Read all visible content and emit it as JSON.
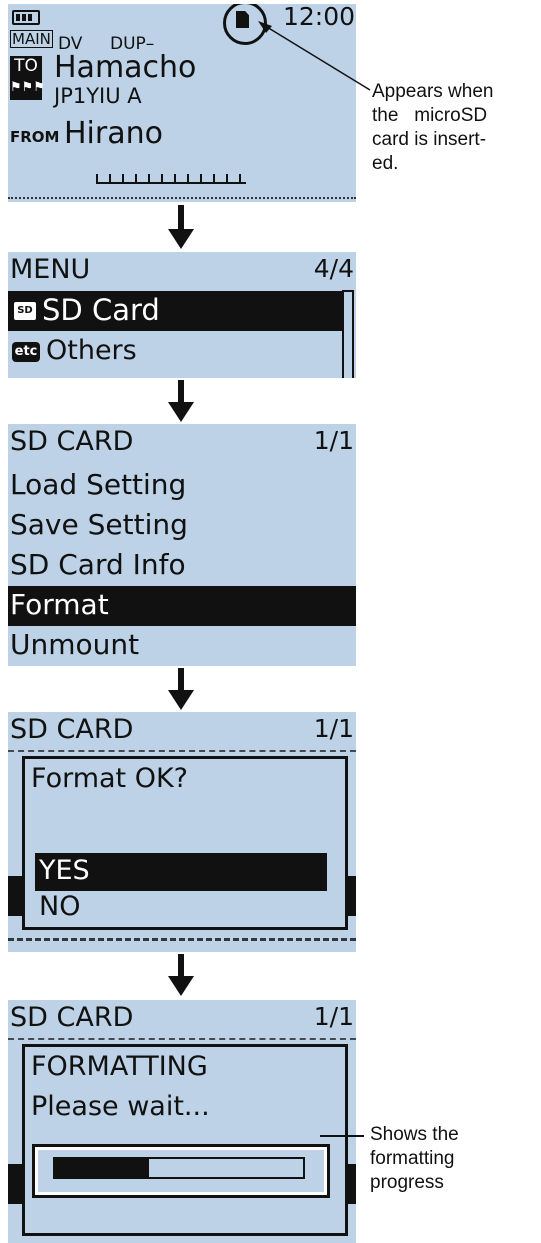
{
  "screen1": {
    "time": "12:00",
    "main_tag": "MAIN",
    "mode": "DV",
    "dup": "DUP–",
    "to_label": "TO",
    "to_name": "Hamacho",
    "to_call": "JP1YIU A",
    "from_label": "FROM",
    "from_name": "Hirano",
    "sd_icon": "sd-card-icon",
    "battery_icon": "battery-icon"
  },
  "callout_top": [
    "Appears when",
    "the   microSD",
    "card is insert-",
    "ed."
  ],
  "screen2": {
    "title": "MENU",
    "page": "4/4",
    "items": [
      {
        "icon": "SD",
        "label": "SD Card"
      },
      {
        "icon": "etc",
        "label": "Others"
      }
    ]
  },
  "screen3": {
    "title": "SD CARD",
    "page": "1/1",
    "items": [
      "Load Setting",
      "Save Setting",
      "SD Card Info",
      "Format",
      "Unmount"
    ],
    "selected": "Format"
  },
  "screen4": {
    "title": "SD CARD",
    "page": "1/1",
    "dialog_title": "Format OK?",
    "options": [
      "YES",
      "NO"
    ],
    "selected": "YES"
  },
  "screen5": {
    "title": "SD CARD",
    "page": "1/1",
    "line1": "FORMATTING",
    "line2": "Please wait...",
    "progress": 0.38
  },
  "callout_bottom": [
    "Shows the",
    "formatting",
    "progress"
  ]
}
